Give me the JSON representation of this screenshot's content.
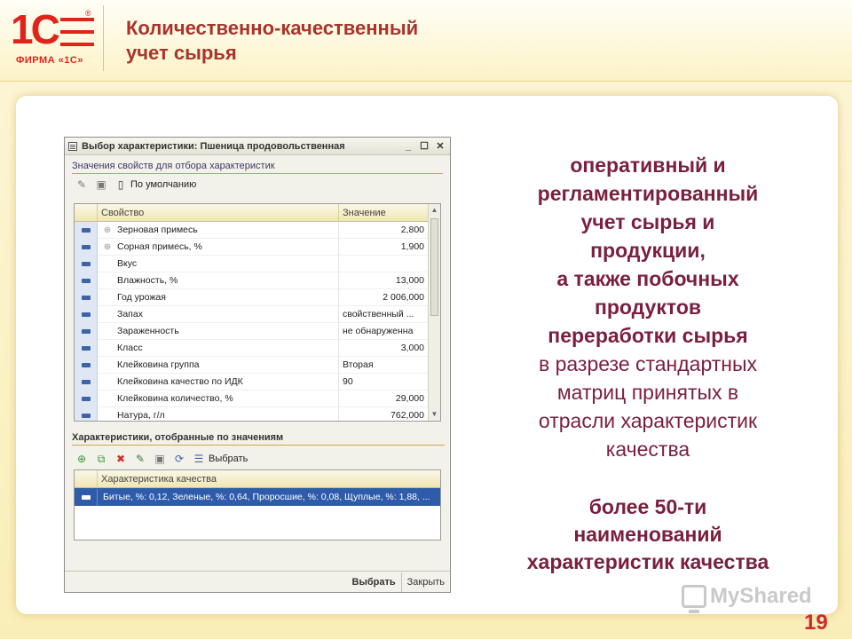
{
  "header": {
    "logo_mark": "1C",
    "logo_text": "ФИРМА «1С»",
    "title_line1": "Количественно-качественный",
    "title_line2": "учет сырья"
  },
  "window": {
    "title": "Выбор характеристики: Пшеница продовольственная",
    "controls": [
      "_",
      "☐",
      "✕"
    ],
    "section1": "Значения свойств для отбора характеристик",
    "toolbar1": {
      "default_label": "По умолчанию"
    },
    "grid": {
      "col_property": "Свойство",
      "col_value": "Значение",
      "rows": [
        {
          "expand": "⊕",
          "property": "Зерновая примесь",
          "value": "2,800",
          "num": true
        },
        {
          "expand": "⊕",
          "property": "Сорная примесь, %",
          "value": "1,900",
          "num": true
        },
        {
          "expand": "",
          "property": "Вкус",
          "value": "",
          "num": false
        },
        {
          "expand": "",
          "property": "Влажность, %",
          "value": "13,000",
          "num": true
        },
        {
          "expand": "",
          "property": "Год урожая",
          "value": "2 006,000",
          "num": true
        },
        {
          "expand": "",
          "property": "Запах",
          "value": "свойственный ...",
          "num": false
        },
        {
          "expand": "",
          "property": "Зараженность",
          "value": "не обнаруженна",
          "num": false
        },
        {
          "expand": "",
          "property": "Класс",
          "value": "3,000",
          "num": true
        },
        {
          "expand": "",
          "property": "Клейковина группа",
          "value": "Вторая",
          "num": false
        },
        {
          "expand": "",
          "property": "Клейковина качество по ИДК",
          "value": "90",
          "num": false
        },
        {
          "expand": "",
          "property": "Клейковина количество, %",
          "value": "29,000",
          "num": true
        },
        {
          "expand": "",
          "property": "Натура, г/л",
          "value": "762,000",
          "num": true
        }
      ]
    },
    "section2": "Характеристики, отобранные по значениям",
    "toolbar2": {
      "select_label": "Выбрать"
    },
    "grid2": {
      "col": "Характеристика качества",
      "row": "Битые, %: 0,12, Зеленые, %: 0,64, Проросшие, %: 0,08, Щуплые, %: 1,88, ..."
    },
    "buttons": {
      "select": "Выбрать",
      "close": "Закрыть"
    }
  },
  "right_text": {
    "bold_lines": [
      "оперативный и",
      "регламентированный",
      "учет сырья и",
      "продукции,",
      "а также побочных",
      "продуктов",
      "переработки сырья"
    ],
    "normal_lines": [
      "в разрезе стандартных",
      "матриц принятых в",
      "отрасли характеристик",
      "качества"
    ],
    "bottom_lines": [
      "более 50-ти",
      "наименований",
      "характеристик качества"
    ]
  },
  "watermark": "MyShared",
  "page_number": "19",
  "colors": {
    "title": "#a9342c",
    "text": "#7a1f3d",
    "logo": "#e2231a",
    "selection": "#2f5caa"
  }
}
